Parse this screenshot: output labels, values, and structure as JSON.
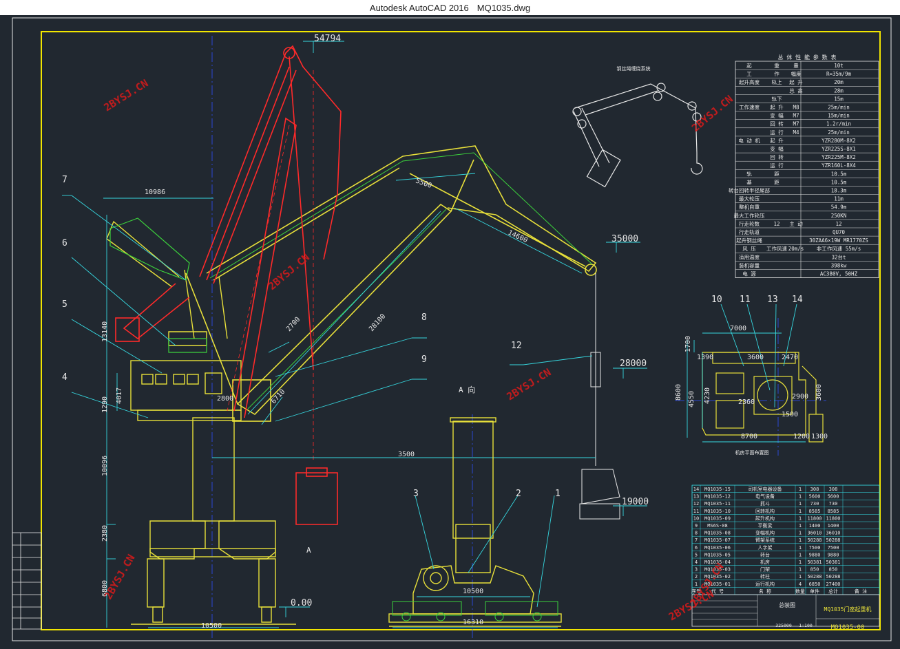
{
  "window": {
    "app_name": "Autodesk AutoCAD 2016",
    "file_name": "MQ1035.dwg"
  },
  "colors": {
    "background": "#212830",
    "frame": "#f2e600",
    "yellow": "#e8e03a",
    "cyan": "#36d8e0",
    "red": "#ff2a2a",
    "white": "#e8e8e8",
    "blue": "#3050ff",
    "green": "#3cd23c",
    "watermark": "#e01a1a"
  },
  "dims": {
    "top_elev": "54794",
    "elev_35000": "35000",
    "elev_28000": "28000",
    "elev_19000": "19000",
    "elev_000": "0.00",
    "d10986": "10986",
    "d13140": "13140",
    "d4017": "4017",
    "d1290": "1290",
    "d10096": "10096",
    "d2380": "2380",
    "d6800": "6800",
    "d10500_left": "10500",
    "d3500": "3500",
    "d5500": "5500",
    "d14600": "14600",
    "d28100": "28100",
    "d2700": "2700",
    "d6710": "6710",
    "d2800": "2800",
    "d10500_mid": "10500",
    "d16310": "16310",
    "d7000": "7000",
    "d1700": "1700",
    "d1390": "1390",
    "d3600": "3600",
    "d2470": "2470",
    "d8600": "8600",
    "d4550": "4550",
    "d4230": "4230",
    "d2360": "2360",
    "d2900": "2900",
    "d3600b": "3600",
    "d1500": "1500",
    "d8700": "8700",
    "d1200": "1200",
    "d1300": "1300"
  },
  "callouts": [
    "1",
    "2",
    "3",
    "4",
    "5",
    "6",
    "7",
    "8",
    "9",
    "10",
    "11",
    "12",
    "13",
    "14"
  ],
  "view_labels": {
    "view_a_title": "A  向",
    "view_a_arrow": "A",
    "plan_caption": "机房平面布置图",
    "reeving_caption": "钢丝绳缠绕系统"
  },
  "spec_table": {
    "title": "总 体 性 能 参 数 表",
    "rows": [
      [
        "起",
        "重",
        "量",
        "10t"
      ],
      [
        "工",
        "作",
        "幅度",
        "R=35m/9m"
      ],
      [
        "起升高度",
        "轨上",
        "起 升",
        "20m"
      ],
      [
        "",
        "",
        "总 高",
        "28m"
      ],
      [
        "",
        "轨下",
        "",
        "15m"
      ],
      [
        "工作速度",
        "起 升",
        "M8",
        "25m/min"
      ],
      [
        "",
        "变 幅",
        "M7",
        "15m/min"
      ],
      [
        "",
        "回 转",
        "M7",
        "1.2r/min"
      ],
      [
        "",
        "运 行",
        "M4",
        "25m/min"
      ],
      [
        "电 动 机",
        "起 升",
        "",
        "YZR280M-8X2"
      ],
      [
        "",
        "变 幅",
        "",
        "YZR225S-8X1"
      ],
      [
        "",
        "回 转",
        "",
        "YZR225M-8X2"
      ],
      [
        "",
        "运 行",
        "",
        "YZR160L-8X4"
      ],
      [
        "轨",
        "距",
        "",
        "10.5m"
      ],
      [
        "基",
        "距",
        "",
        "10.5m"
      ],
      [
        "转台回转半径尾部",
        "",
        "",
        "18.3m"
      ],
      [
        "最大轮压",
        "",
        "",
        "11m"
      ],
      [
        "整机自重",
        "",
        "",
        "54.9m"
      ],
      [
        "最大工作轮压",
        "",
        "",
        "250KN"
      ],
      [
        "行走轮数",
        "12",
        "主 动",
        "12"
      ],
      [
        "行走轨道",
        "",
        "",
        "QU70"
      ],
      [
        "起升钢丝绳",
        "",
        "",
        "30ZAA6×19W MR1770ZS"
      ],
      [
        "风 压",
        "工作风速",
        "20m/s",
        "非工作风速 55m/s"
      ],
      [
        "适用温度",
        "",
        "",
        "32台t"
      ],
      [
        "装机容量",
        "",
        "",
        "398kw"
      ],
      [
        "电 源",
        "",
        "",
        "AC380V, 50HZ"
      ]
    ]
  },
  "parts_list": {
    "rows": [
      [
        "14",
        "MQ1035-15",
        "司机室电器设备",
        "1",
        "308",
        "308"
      ],
      [
        "13",
        "MQ1035-12",
        "电气设备",
        "1",
        "5600",
        "5600"
      ],
      [
        "12",
        "MQ1035-11",
        "抓斗",
        "1",
        "730",
        "730"
      ],
      [
        "11",
        "MQ1035-10",
        "回转机构",
        "1",
        "8585",
        "8585"
      ],
      [
        "10",
        "MQ1035-09",
        "起升机构",
        "1",
        "11800",
        "11800"
      ],
      [
        "9",
        "MS6S-08",
        "平衡梁",
        "1",
        "1400",
        "1400"
      ],
      [
        "8",
        "MQ1035-08",
        "变幅机构",
        "1",
        "36010",
        "36010"
      ],
      [
        "7",
        "MQ1035-07",
        "臂架系统",
        "1",
        "50288",
        "50288"
      ],
      [
        "6",
        "MQ1035-06",
        "人字架",
        "1",
        "7500",
        "7500"
      ],
      [
        "5",
        "MQ1035-05",
        "转台",
        "1",
        "9880",
        "9880"
      ],
      [
        "4",
        "MQ1035-04",
        "机房",
        "1",
        "50381",
        "50381"
      ],
      [
        "3",
        "MQ1035-03",
        "门架",
        "1",
        "850",
        "850"
      ],
      [
        "2",
        "MQ1035-02",
        "转柱",
        "1",
        "50288",
        "50288"
      ],
      [
        "1",
        "MQ1035-01",
        "运行机构",
        "4",
        "6850",
        "27400"
      ]
    ],
    "header": [
      "序号",
      "代 号",
      "名 称",
      "数量",
      "单件",
      "总计",
      "备 注"
    ]
  },
  "title_block": {
    "drawing_name": "MQ1035门座起重机",
    "drawing_no": "MQ1035-00",
    "assembly": "总装图",
    "weight": "325000",
    "scale": "1:100"
  },
  "watermarks": [
    "2BYSJ.CN",
    "2BYSJ.CN",
    "2BYSJ.CN",
    "2BYSJ.CN",
    "2BYSJ.CN",
    "2BYSJ.CN",
    "2BYSJ.CN"
  ]
}
